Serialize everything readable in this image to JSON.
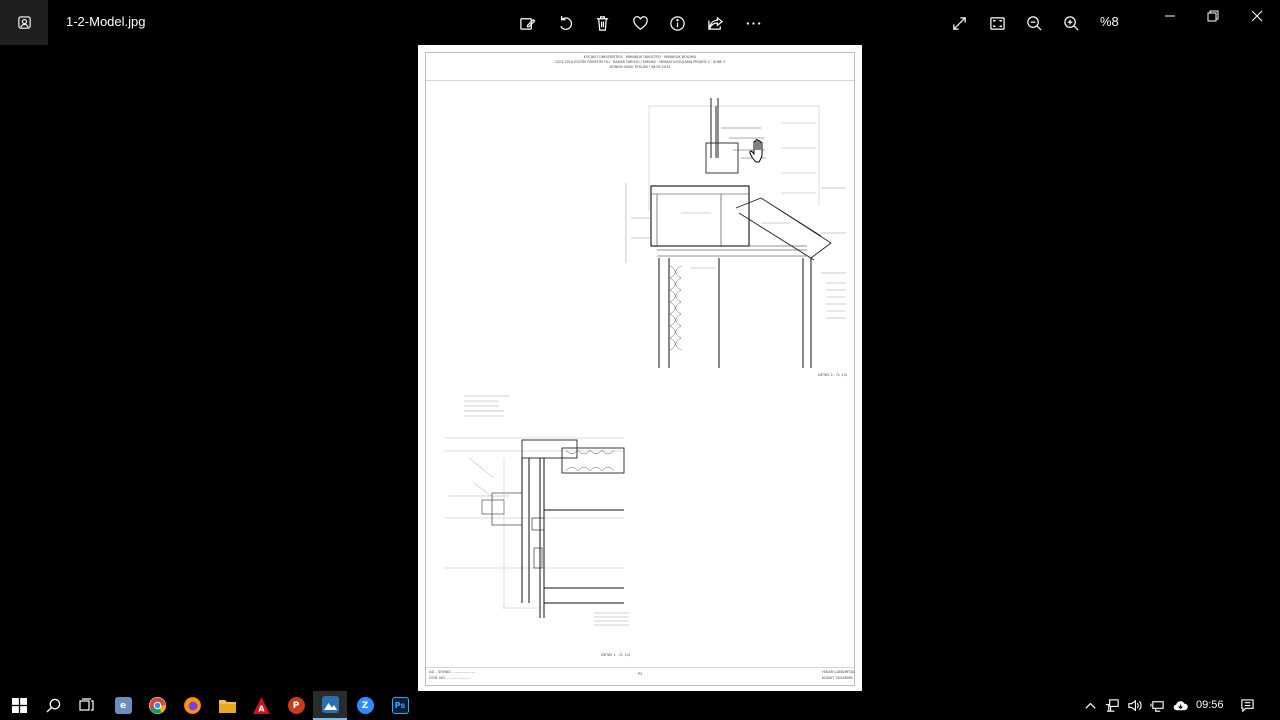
{
  "window": {
    "file_name": "1-2-Model.jpg",
    "zoom_label": "%8"
  },
  "document": {
    "header_lines": [
      "KOCAELİ ÜNİVERSİTESİ · MİMARLIK FAKÜLTESİ · MİMARLIK BÖLÜMÜ",
      "2023-2024 EĞİTİM ÖĞRETİM YILI · BAHAR YARIYILI / MİM362 · MİMARİ UYGULAMA PROJESİ 2 · ŞUBE 2",
      "DÖNEM SONU TESLİMİ / 08.05.2024"
    ],
    "detail_label_top": "DETAY 2 - Ö: 1/2",
    "detail_label_bottom": "DETAY 1 - Ö: 1/2",
    "footer_left_1": "AD - SOYAD: ....................",
    "footer_left_2": "ÖĞR. NO: ....................",
    "footer_page": "P2",
    "footer_right_1": "HİSAR ÇANDIR'DA",
    "footer_right_2": "KONUT TASARIMI"
  },
  "taskbar": {
    "time": "09:56",
    "apps": [
      {
        "name": "edge-icon",
        "color": "#6c8ebf",
        "glyph": "e"
      },
      {
        "name": "chrome-icon",
        "color": "#db4437",
        "glyph": "●"
      },
      {
        "name": "firefox-icon",
        "color": "#e66000",
        "glyph": "f"
      },
      {
        "name": "file-explorer-icon",
        "color": "#e8b22b",
        "glyph": "▬"
      },
      {
        "name": "autocad-icon",
        "color": "#c4161c",
        "glyph": "A"
      },
      {
        "name": "powerpoint-icon",
        "color": "#c43e1c",
        "glyph": "P"
      },
      {
        "name": "photos-icon",
        "color": "#2b6fb3",
        "glyph": "▲"
      },
      {
        "name": "zoom-app-icon",
        "color": "#2d8cff",
        "glyph": "Z"
      },
      {
        "name": "photoshop-icon",
        "color": "#001e36",
        "glyph": "Ps"
      }
    ]
  }
}
